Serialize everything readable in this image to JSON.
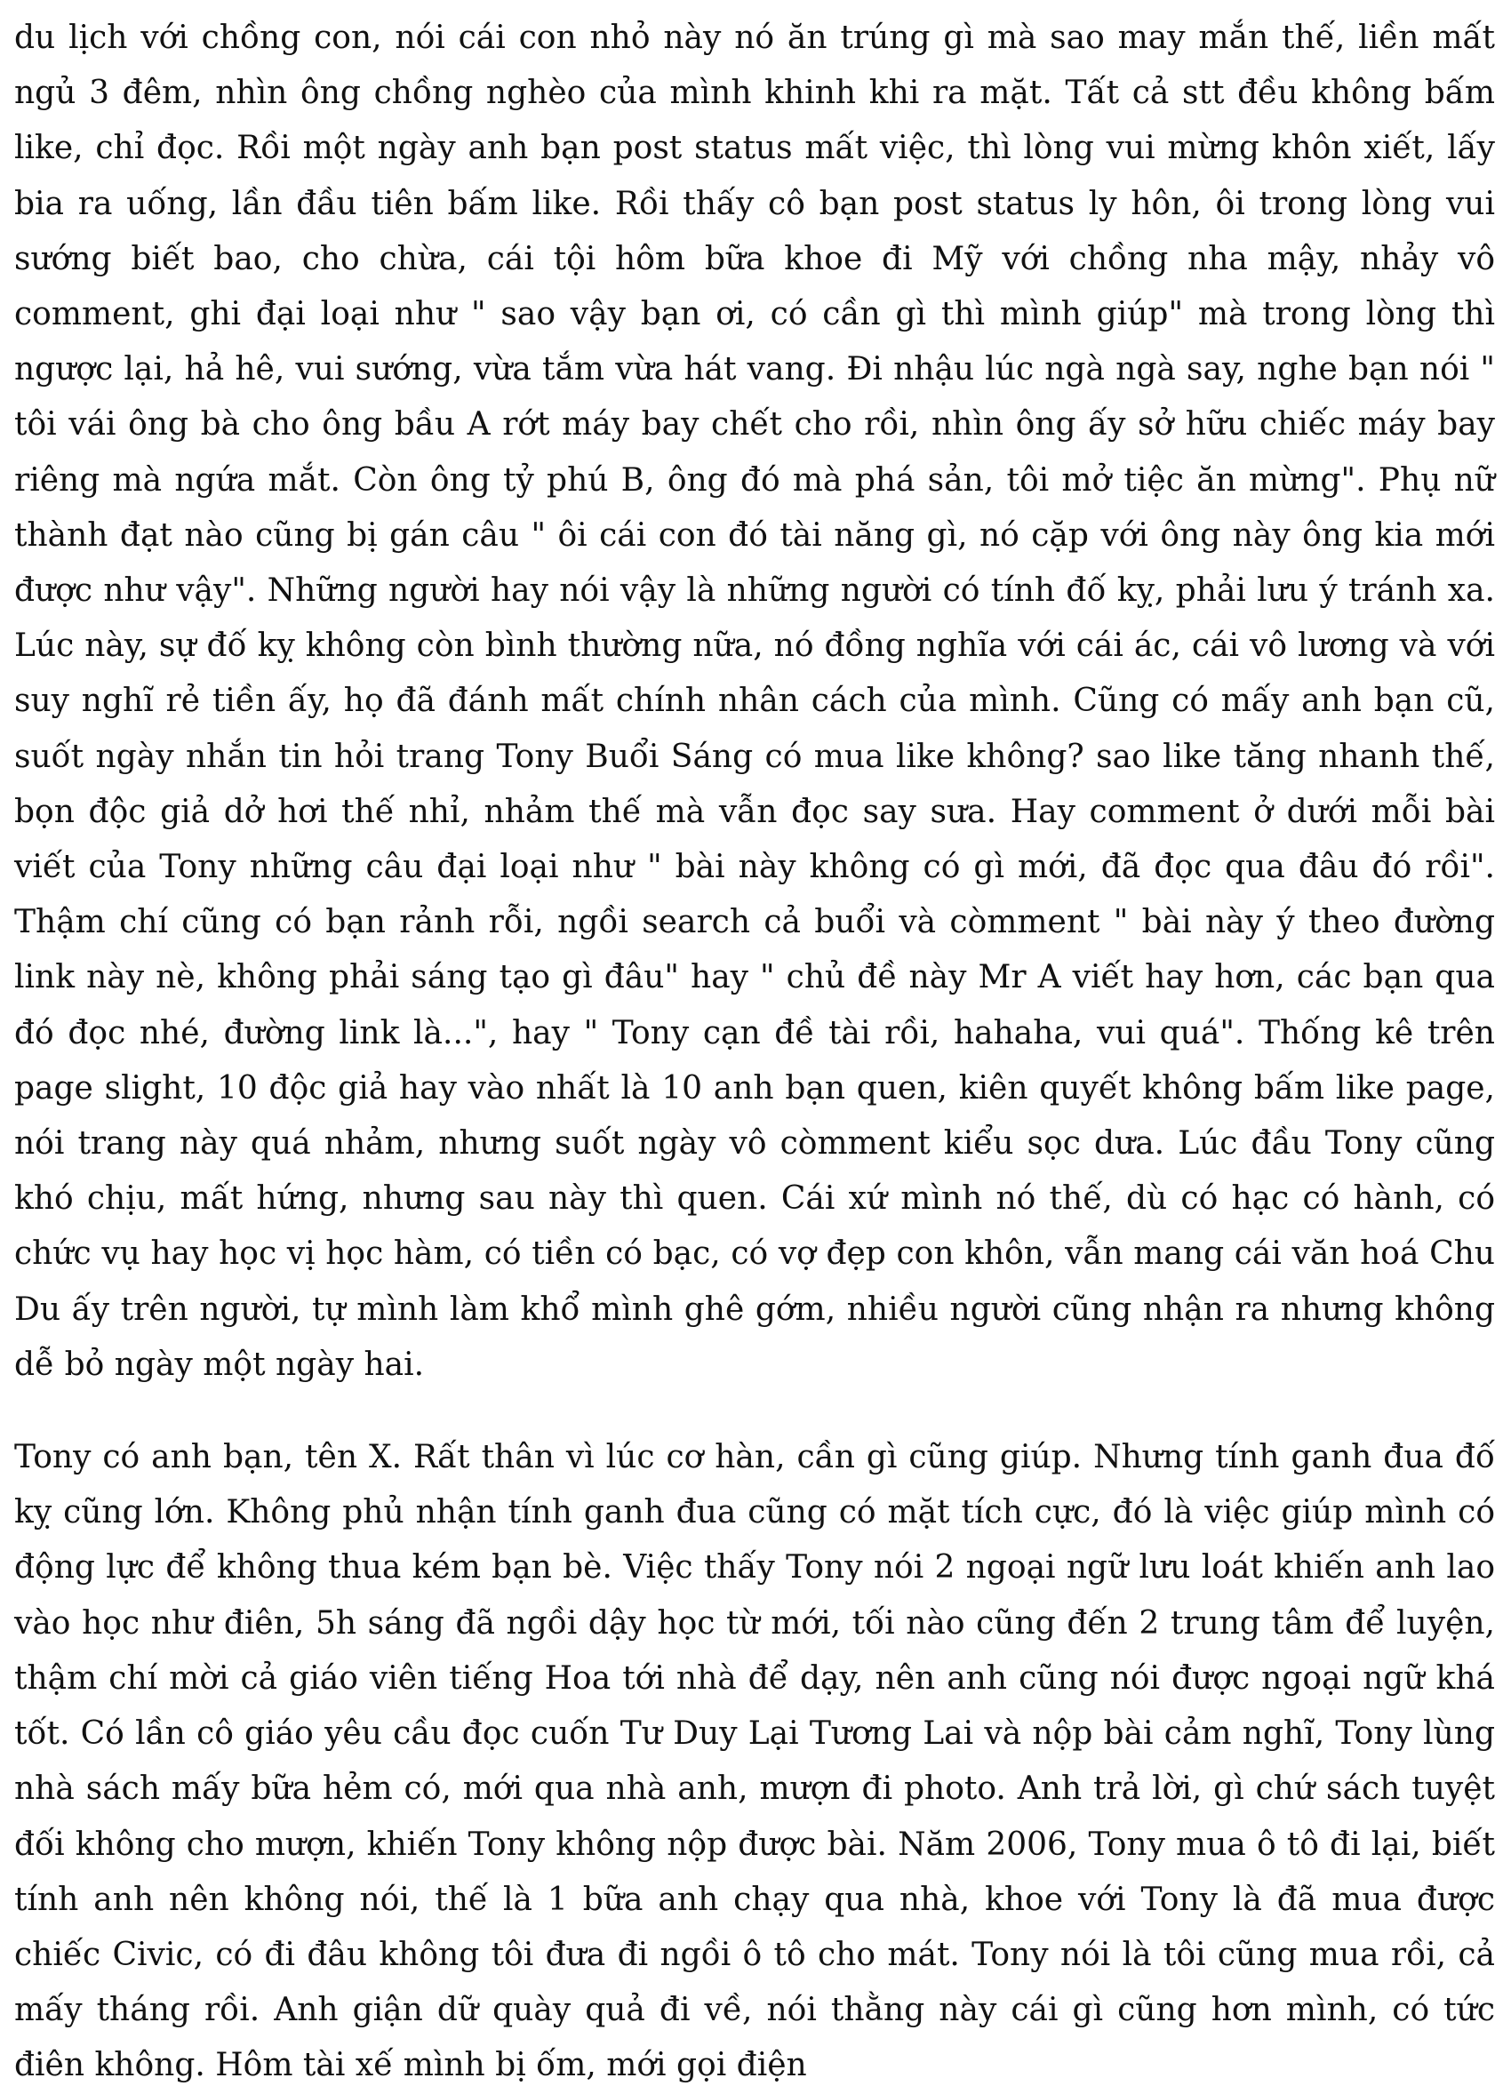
{
  "document": {
    "paragraphs": [
      "du lịch với chồng con, nói cái con nhỏ này nó ăn trúng gì mà sao may mắn thế, liền mất ngủ 3 đêm, nhìn ông chồng nghèo của mình khinh khi ra mặt. Tất cả stt đều không bấm like, chỉ đọc. Rồi một ngày anh bạn post status mất việc, thì lòng vui mừng khôn xiết, lấy bia ra uống, lần đầu tiên bấm like. Rồi thấy cô bạn post status ly hôn, ôi trong lòng vui sướng biết bao, cho chừa, cái tội hôm bữa khoe đi Mỹ với chồng nha mậy, nhảy vô comment, ghi đại loại như \" sao vậy bạn ơi, có cần gì thì mình giúp\" mà trong lòng thì ngược lại, hả hê, vui sướng, vừa tắm vừa hát vang. Đi nhậu lúc ngà ngà say, nghe bạn nói \" tôi vái ông bà cho ông bầu A rớt máy bay chết cho rồi, nhìn ông ấy sở hữu chiếc máy bay riêng mà ngứa mắt. Còn ông tỷ phú B, ông đó mà phá sản, tôi mở tiệc ăn mừng\". Phụ nữ thành đạt nào cũng bị gán câu \" ôi cái con đó tài năng gì, nó cặp với ông này ông kia mới được như vậy\". Những người hay nói vậy là những người có tính đố kỵ, phải lưu ý tránh xa. Lúc này, sự đố kỵ không còn bình thường nữa, nó đồng nghĩa với cái ác, cái vô lương và với suy nghĩ rẻ tiền ấy, họ đã đánh mất chính nhân cách của mình. Cũng có mấy anh bạn cũ, suốt ngày nhắn tin hỏi trang Tony Buổi Sáng có mua like không? sao like tăng nhanh thế, bọn độc giả dở hơi thế nhỉ, nhảm thế mà vẫn đọc say sưa. Hay comment ở dưới mỗi bài viết của Tony những câu đại loại như \" bài này không có gì mới, đã đọc qua đâu đó rồi\". Thậm chí cũng có bạn rảnh rỗi, ngồi search cả buổi và còmment \" bài này ý theo đường link này nè, không phải sáng tạo gì đâu\" hay \" chủ đề này Mr A viết hay hơn, các bạn qua đó đọc nhé, đường link là...\", hay \" Tony cạn đề tài rồi, hahaha, vui quá\". Thống kê trên page slight, 10 độc giả hay vào nhất là 10 anh bạn quen, kiên quyết không bấm like page, nói trang này quá nhảm, nhưng suốt ngày vô còmment kiểu sọc dưa. Lúc đầu Tony cũng khó chịu, mất hứng, nhưng sau này thì quen. Cái xứ mình nó thế, dù có hạc có hành, có chức vụ hay học vị học hàm, có tiền có bạc, có vợ đẹp con khôn, vẫn mang cái văn hoá Chu Du ấy trên người, tự mình làm khổ mình ghê gớm, nhiều người cũng nhận ra nhưng không dễ bỏ ngày một ngày hai.",
      "Tony có anh bạn, tên X. Rất thân vì lúc cơ hàn, cần gì cũng giúp. Nhưng tính ganh đua đố kỵ cũng lớn. Không phủ nhận tính ganh đua cũng có mặt tích cực, đó là việc giúp mình có động lực để không thua kém bạn bè. Việc thấy Tony nói 2 ngoại ngữ lưu loát khiến anh lao vào học như điên, 5h sáng đã ngồi dậy học từ mới, tối nào cũng đến 2 trung tâm để luyện, thậm chí mời cả giáo viên tiếng Hoa tới nhà để dạy, nên anh cũng nói được ngoại ngữ khá tốt. Có lần cô giáo yêu cầu đọc cuốn Tư Duy Lại Tương Lai và nộp bài cảm nghĩ, Tony lùng nhà sách mấy bữa hẻm có, mới qua nhà anh, mượn đi photo. Anh trả lời, gì chứ sách tuyệt đối không cho mượn, khiến Tony không nộp được bài. Năm 2006, Tony mua ô tô đi lại, biết tính anh nên không nói, thế là 1 bữa anh chạy qua nhà, khoe với Tony là đã mua được chiếc Civic, có đi đâu không tôi đưa đi ngồi ô tô cho mát. Tony nói là tôi cũng mua rồi, cả mấy tháng rồi. Anh giận dữ quày quả đi về, nói thằng này cái gì cũng hơn mình, có tức điên không. Hôm tài xế mình bị ốm, mới gọi điện"
    ]
  }
}
